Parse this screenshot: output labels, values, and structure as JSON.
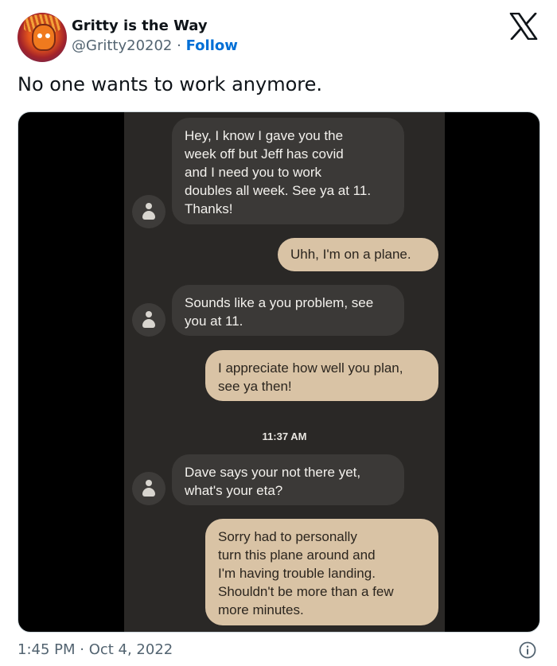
{
  "author": {
    "display_name": "Gritty is the Way",
    "handle": "@Gritty20202",
    "separator": "·",
    "follow_label": "Follow"
  },
  "tweet": {
    "text": "No one wants to work anymore.",
    "timestamp": "1:45 PM · Oct 4, 2022"
  },
  "icons": {
    "logo": "x-logo-icon",
    "info": "info-icon",
    "contact": "contact-person-icon"
  },
  "colors": {
    "follow_blue": "#006fd6",
    "sent_bubble": "#d9c3a5",
    "received_bubble": "#3b3937",
    "phone_background": "#2a2826"
  },
  "messages": [
    {
      "direction": "received",
      "lines": [
        "Hey, I know I gave you the",
        "week off but Jeff has covid",
        "and I need you to work",
        "doubles all week. See ya at 11.",
        "Thanks!"
      ]
    },
    {
      "direction": "sent",
      "lines": [
        "Uhh, I'm on a plane."
      ]
    },
    {
      "direction": "received",
      "lines": [
        "Sounds like a you problem, see",
        "you at 11."
      ]
    },
    {
      "direction": "sent",
      "lines": [
        "I appreciate how well you plan,",
        "see ya then!"
      ]
    },
    {
      "direction": "received",
      "lines": [
        "Dave says your not there yet,",
        "what's your eta?"
      ]
    },
    {
      "direction": "sent",
      "lines": [
        "Sorry had to personally",
        "turn this plane around and",
        "I'm having trouble landing.",
        "Shouldn't be more than a few",
        "more minutes."
      ]
    }
  ],
  "message_time": "11:37 AM"
}
